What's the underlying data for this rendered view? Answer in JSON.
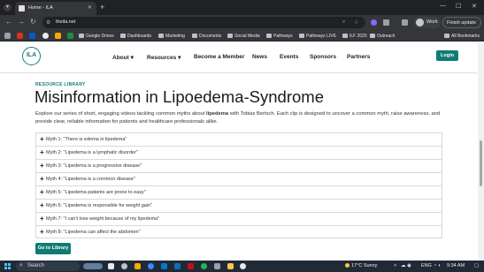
{
  "browser": {
    "tab_title": "Home - ILA",
    "url": "theila.net",
    "profile_label": "Work",
    "update_label": "Finish update",
    "bookmarks": [
      {
        "label": "Google Drives",
        "type": "folder"
      },
      {
        "label": "Dashboards",
        "type": "folder"
      },
      {
        "label": "Marketing",
        "type": "folder"
      },
      {
        "label": "Documents",
        "type": "folder"
      },
      {
        "label": "Social Media",
        "type": "folder"
      },
      {
        "label": "Pathways",
        "type": "folder"
      },
      {
        "label": "Pathways LIVE",
        "type": "folder"
      },
      {
        "label": "ILF 2025",
        "type": "folder"
      },
      {
        "label": "Outreach",
        "type": "folder"
      }
    ],
    "all_bookmarks_label": "All Bookmarks"
  },
  "site": {
    "logo_text": "ILA",
    "nav": [
      {
        "label": "About",
        "has_dropdown": true
      },
      {
        "label": "Resources",
        "has_dropdown": true
      },
      {
        "label": "Become a Member",
        "has_dropdown": false
      },
      {
        "label": "News",
        "has_dropdown": false
      },
      {
        "label": "Events",
        "has_dropdown": false
      },
      {
        "label": "Sponsors",
        "has_dropdown": false
      },
      {
        "label": "Partners",
        "has_dropdown": false
      }
    ],
    "login_label": "Login"
  },
  "content": {
    "kicker": "RESOURCE LIBRARY",
    "title": "Misinformation in Lipoedema-Syndrome",
    "desc_before": "Explore our series of short, engaging videos tackling common myths about ",
    "desc_bold": "lipedema",
    "desc_after": " with Tobias Bertsch. Each clip is designed to uncover  a common myth, raise awareness, and provide clear, reliable information for patients and healthcare professionals alike.",
    "myths": [
      "Myth 1: \"There is edema in lipedema\"",
      "Myth 2: \"Lipedema is a lymphatic disorder\"",
      "Myth 3: \"Lipedema is a progressive disease\"",
      "Myth 4: \"Lipedema is a common disease\"",
      "Myth 5: \"Lipedema patients are prone to easy\"",
      "Myth 6: \"Lipedema is responsible for weight gain\"",
      "Myth 7: \"I can't lose weight because of my lipedema\"",
      "Myth 8: \"Lipedema can affect the abdomen\""
    ],
    "cta_label": "Go to Library"
  },
  "taskbar": {
    "search_label": "Search",
    "temperature": "17°C",
    "weather_text": "Sunny",
    "language": "ENG",
    "time": "9:34 AM"
  }
}
